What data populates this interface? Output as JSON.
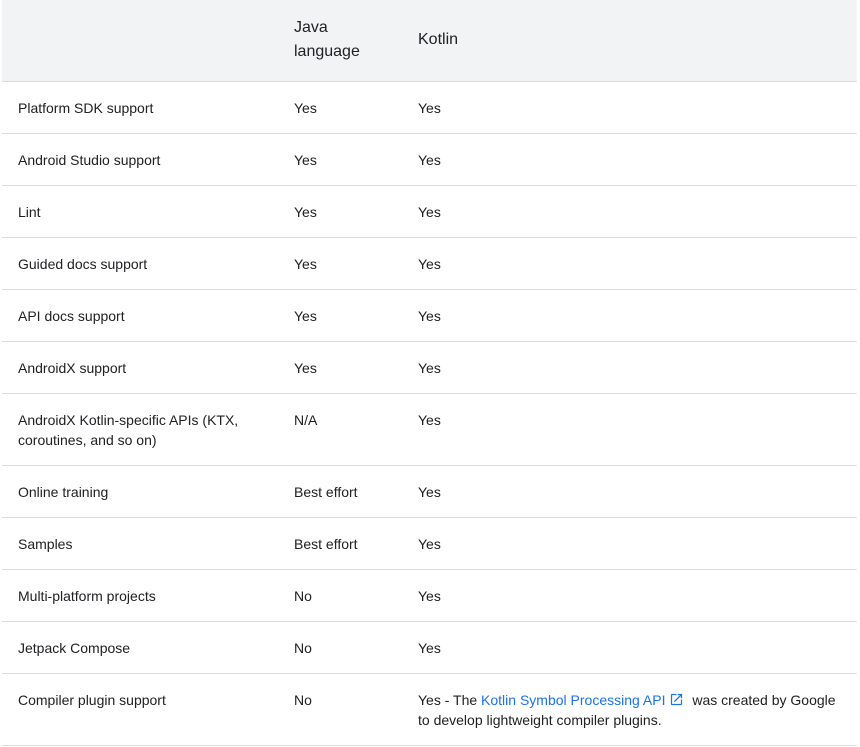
{
  "table": {
    "headers": [
      "",
      "Java language",
      "Kotlin"
    ],
    "java_header_line1": "Java",
    "java_header_line2": "language",
    "rows": [
      {
        "feature": "Platform SDK support",
        "java": "Yes",
        "kotlin": "Yes"
      },
      {
        "feature": "Android Studio support",
        "java": "Yes",
        "kotlin": "Yes"
      },
      {
        "feature": "Lint",
        "java": "Yes",
        "kotlin": "Yes"
      },
      {
        "feature": "Guided docs support",
        "java": "Yes",
        "kotlin": "Yes"
      },
      {
        "feature": "API docs support",
        "java": "Yes",
        "kotlin": "Yes"
      },
      {
        "feature": "AndroidX support",
        "java": "Yes",
        "kotlin": "Yes"
      },
      {
        "feature": "AndroidX Kotlin-specific APIs (KTX, coroutines, and so on)",
        "java": "N/A",
        "kotlin": "Yes"
      },
      {
        "feature": "Online training",
        "java": "Best effort",
        "kotlin": "Yes"
      },
      {
        "feature": "Samples",
        "java": "Best effort",
        "kotlin": "Yes"
      },
      {
        "feature": "Multi-platform projects",
        "java": "No",
        "kotlin": "Yes"
      },
      {
        "feature": "Jetpack Compose",
        "java": "No",
        "kotlin": "Yes"
      }
    ],
    "last_row": {
      "feature": "Compiler plugin support",
      "java": "No",
      "kotlin_prefix": "Yes - The ",
      "kotlin_link": "Kotlin Symbol Processing API",
      "kotlin_suffix": " was created by Google to develop lightweight compiler plugins.",
      "link_icon": "external-link-icon"
    }
  },
  "colors": {
    "header_bg": "#f1f3f4",
    "border": "#dadce0",
    "text": "#202124",
    "link": "#1a73e8"
  }
}
